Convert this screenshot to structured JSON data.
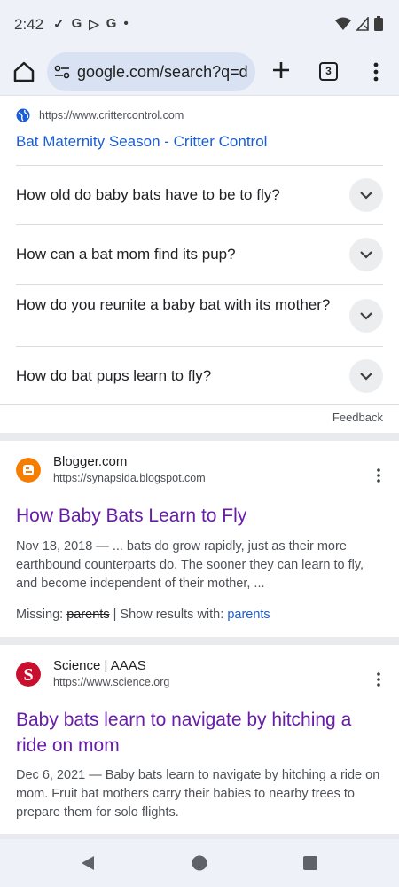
{
  "status_bar": {
    "time": "2:42",
    "notif_glyphs": [
      "✓",
      "G",
      "▷",
      "G",
      "•"
    ]
  },
  "browser": {
    "url": "google.com/search?q=d",
    "tab_count": "3"
  },
  "top_result": {
    "source_url": "https://www.crittercontrol.com",
    "link_text": "Bat Maternity Season - Critter Control"
  },
  "faq": [
    {
      "question": "How old do baby bats have to be to fly?"
    },
    {
      "question": "How can a bat mom find its pup?"
    },
    {
      "question": "How do you reunite a baby bat with its mother?"
    },
    {
      "question": "How do bat pups learn to fly?"
    }
  ],
  "feedback_label": "Feedback",
  "results": [
    {
      "site_name": "Blogger.com",
      "site_url": "https://synapsida.blogspot.com",
      "title": "How Baby Bats Learn to Fly",
      "snippet": "Nov 18, 2018 — ... bats do grow rapidly, just as their more earthbound counterparts do. The sooner they can learn to fly, and become independent of their mother, ...",
      "missing_label": "Missing:",
      "missing_term": "parents",
      "show_results_label": "| Show results with:",
      "show_results_term": "parents",
      "favicon_color": "#f57d00"
    },
    {
      "site_name": "Science | AAAS",
      "site_url": "https://www.science.org",
      "title": "Baby bats learn to navigate by hitching a ride on mom",
      "snippet": "Dec 6, 2021 — Baby bats learn to navigate by hitching a ride on mom. Fruit bat mothers carry their babies to nearby trees to prepare them for solo flights.",
      "favicon_color": "#c8102e"
    }
  ],
  "colors": {
    "link_blue": "#1a5dd6",
    "visited_purple": "#681da8",
    "chrome_bg": "#eef2f8"
  }
}
